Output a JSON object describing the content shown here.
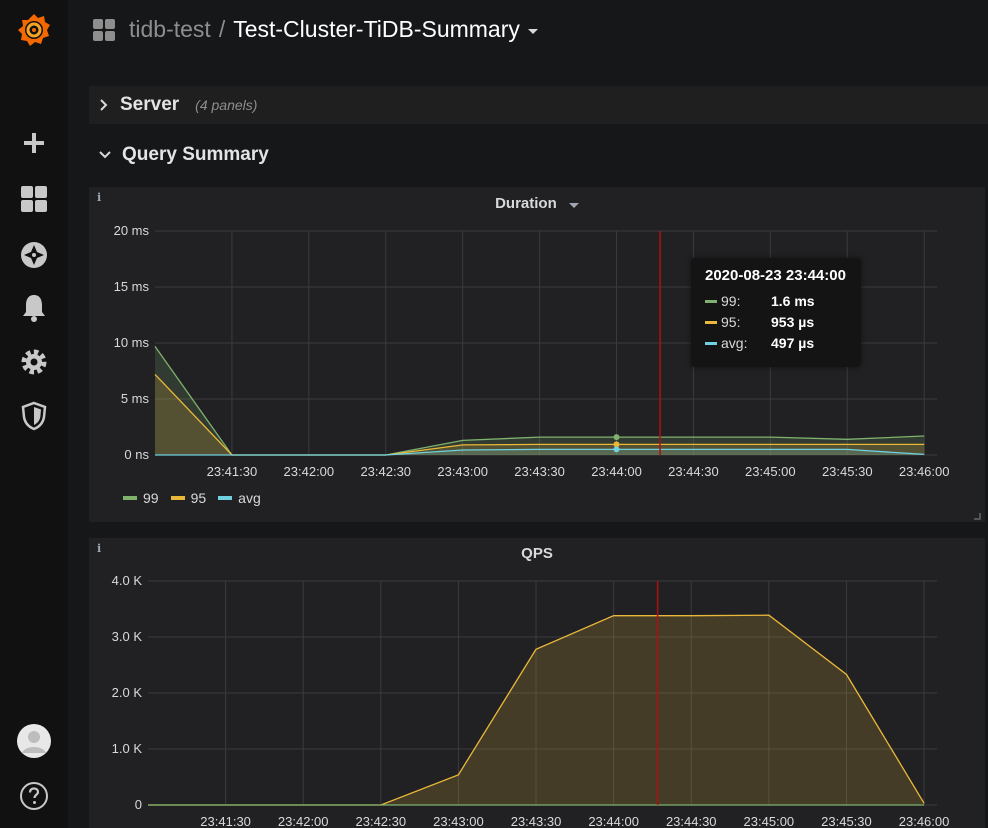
{
  "breadcrumb": {
    "folder": "tidb-test",
    "separator": "/",
    "title": "Test-Cluster-TiDB-Summary"
  },
  "sidemenu": {
    "items": [
      {
        "icon": "grafana-logo-icon"
      },
      {
        "icon": "plus-icon"
      },
      {
        "icon": "dashboards-grid-icon"
      },
      {
        "icon": "compass-explore-icon"
      },
      {
        "icon": "bell-alerting-icon"
      },
      {
        "icon": "gear-configuration-icon"
      },
      {
        "icon": "shield-server-admin-icon"
      },
      {
        "icon": "user-avatar-icon"
      },
      {
        "icon": "help-question-icon"
      }
    ]
  },
  "rows": {
    "server": {
      "title": "Server",
      "count": "(4 panels)"
    },
    "query_summary": {
      "title": "Query Summary"
    }
  },
  "panels": {
    "duration": {
      "info": "i",
      "title": "Duration",
      "tooltip": {
        "time": "2020-08-23 23:44:00",
        "rows": [
          {
            "name": "99:",
            "value": "1.6 ms",
            "color": "#7eb26d"
          },
          {
            "name": "95:",
            "value": "953 µs",
            "color": "#eab839"
          },
          {
            "name": "avg:",
            "value": "497 µs",
            "color": "#6ed0e0"
          }
        ]
      },
      "legend": [
        {
          "name": "99",
          "color": "#7eb26d"
        },
        {
          "name": "95",
          "color": "#eab839"
        },
        {
          "name": "avg",
          "color": "#6ed0e0"
        }
      ]
    },
    "qps": {
      "info": "i",
      "title": "QPS"
    }
  },
  "chart_data": [
    {
      "type": "line",
      "title": "Duration",
      "x": [
        "23:41:00",
        "23:41:30",
        "23:42:00",
        "23:42:30",
        "23:43:00",
        "23:43:30",
        "23:44:00",
        "23:44:30",
        "23:45:00",
        "23:45:30",
        "23:46:00"
      ],
      "x_tick_labels": [
        "23:41:30",
        "23:42:00",
        "23:42:30",
        "23:43:00",
        "23:43:30",
        "23:44:00",
        "23:44:30",
        "23:45:00",
        "23:45:30",
        "23:46:00"
      ],
      "y_ticks": [
        0,
        5,
        10,
        15,
        20
      ],
      "y_tick_labels": [
        "0 ns",
        "5 ms",
        "10 ms",
        "15 ms",
        "20 ms"
      ],
      "ylim": [
        0,
        20
      ],
      "yunit": "ms",
      "series": [
        {
          "name": "99",
          "color": "#7eb26d",
          "values": [
            9.7,
            0,
            0,
            0,
            1.3,
            1.6,
            1.6,
            1.6,
            1.6,
            1.4,
            1.7
          ]
        },
        {
          "name": "95",
          "color": "#eab839",
          "values": [
            7.2,
            0,
            0,
            0,
            0.9,
            0.95,
            0.95,
            0.95,
            0.95,
            0.95,
            0.95
          ]
        },
        {
          "name": "avg",
          "color": "#6ed0e0",
          "values": [
            0,
            0,
            0,
            0,
            0.45,
            0.5,
            0.5,
            0.5,
            0.5,
            0.5,
            0.05
          ]
        }
      ],
      "hover_x": "23:44:17",
      "grid": true,
      "legend": "bottom"
    },
    {
      "type": "area",
      "title": "QPS",
      "x": [
        "23:41:00",
        "23:41:30",
        "23:42:00",
        "23:42:30",
        "23:43:00",
        "23:43:30",
        "23:44:00",
        "23:44:30",
        "23:45:00",
        "23:45:30",
        "23:46:00"
      ],
      "x_tick_labels": [
        "23:41:30",
        "23:42:00",
        "23:42:30",
        "23:43:00",
        "23:43:30",
        "23:44:00",
        "23:44:30",
        "23:45:00",
        "23:45:30",
        "23:46:00"
      ],
      "y_ticks": [
        0,
        1000,
        2000,
        3000,
        4000
      ],
      "y_tick_labels": [
        "0",
        "1.0 K",
        "2.0 K",
        "3.0 K",
        "4.0 K"
      ],
      "ylim": [
        0,
        4000
      ],
      "series": [
        {
          "color": "#eab839",
          "values": [
            0,
            0,
            0,
            0,
            540,
            2780,
            3380,
            3380,
            3390,
            2330,
            30
          ]
        },
        {
          "color": "#7eb26d",
          "values": [
            0,
            0,
            0,
            0,
            0,
            0,
            0,
            0,
            0,
            0,
            0
          ]
        }
      ],
      "hover_x": "23:44:17",
      "grid": true
    }
  ]
}
